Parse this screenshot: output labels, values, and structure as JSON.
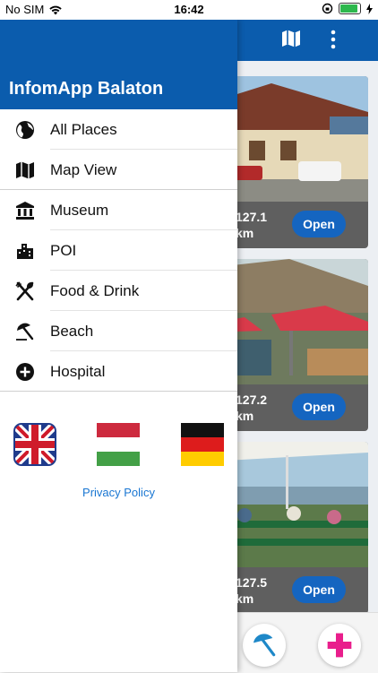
{
  "status_bar": {
    "carrier": "No SIM",
    "time": "16:42"
  },
  "drawer": {
    "title": "InfomApp Balaton",
    "items": [
      {
        "label": "All Places",
        "icon": "globe-icon"
      },
      {
        "label": "Map View",
        "icon": "map-icon"
      },
      {
        "label": "Museum",
        "icon": "museum-icon"
      },
      {
        "label": "POI",
        "icon": "city-icon"
      },
      {
        "label": "Food & Drink",
        "icon": "utensils-icon"
      },
      {
        "label": "Beach",
        "icon": "beach-umbrella-icon"
      },
      {
        "label": "Hospital",
        "icon": "plus-circle-icon"
      }
    ],
    "languages": [
      "english-flag-icon",
      "hungarian-flag-icon",
      "german-flag-icon"
    ],
    "privacy_label": "Privacy Policy"
  },
  "list": {
    "cards": [
      {
        "distance": "127.1",
        "unit": "km",
        "open_label": "Open"
      },
      {
        "distance": "127.2",
        "unit": "km",
        "open_label": "Open"
      },
      {
        "distance": "127.5",
        "unit": "km",
        "open_label": "Open"
      }
    ]
  },
  "colors": {
    "primary": "#0b5cad",
    "button": "#1565c0",
    "beach_fab": "#1e88c8",
    "hospital_fab": "#e91e8c"
  }
}
